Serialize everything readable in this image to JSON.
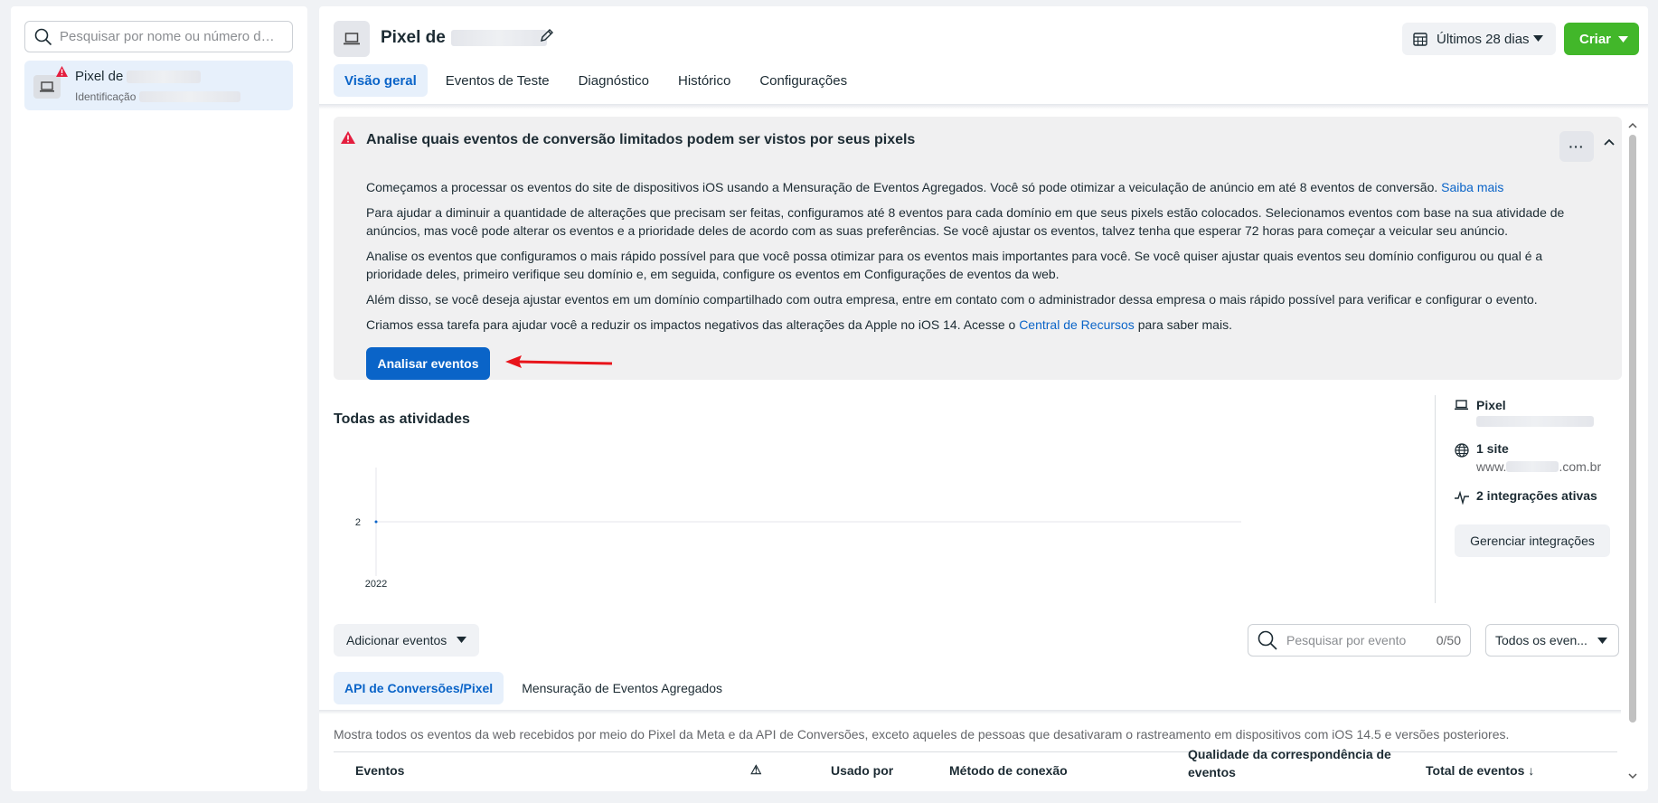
{
  "sidebar": {
    "search_placeholder": "Pesquisar por nome ou número de ide...",
    "pixel_name_prefix": "Pixel de",
    "pixel_sub_prefix": "Identificação"
  },
  "header": {
    "title_prefix": "Pixel de",
    "date_range": "Últimos 28 dias",
    "create_label": "Criar"
  },
  "tabs": [
    {
      "label": "Visão geral"
    },
    {
      "label": "Eventos de Teste"
    },
    {
      "label": "Diagnóstico"
    },
    {
      "label": "Histórico"
    },
    {
      "label": "Configurações"
    }
  ],
  "alert": {
    "title": "Analise quais eventos de conversão limitados podem ser vistos por seus pixels",
    "p1": "Começamos a processar os eventos do site de dispositivos iOS usando a Mensuração de Eventos Agregados. Você só pode otimizar a veiculação de anúncio em até 8 eventos de conversão.",
    "p1_link": "Saiba mais",
    "p2": "Para ajudar a diminuir a quantidade de alterações que precisam ser feitas, configuramos até 8 eventos para cada domínio em que seus pixels estão colocados. Selecionamos eventos com base na sua atividade de anúncios, mas você pode alterar os eventos e a prioridade deles de acordo com as suas preferências. Se você ajustar os eventos, talvez tenha que esperar 72 horas para começar a veicular seu anúncio.",
    "p3": "Analise os eventos que configuramos o mais rápido possível para que você possa otimizar para os eventos mais importantes para você. Se você quiser ajustar quais eventos seu domínio configurou ou qual é a prioridade deles, primeiro verifique seu domínio e, em seguida, configure os eventos em Configurações de eventos da web.",
    "p4": "Além disso, se você deseja ajustar eventos em um domínio compartilhado com outra empresa, entre em contato com o administrador dessa empresa o mais rápido possível para verificar e configurar o evento.",
    "p5_before": "Criamos essa tarefa para ajudar você a reduzir os impactos negativos das alterações da Apple no iOS 14. Acesse o",
    "p5_link": "Central de Recursos",
    "p5_after": "para saber mais.",
    "button": "Analisar eventos",
    "more": "···"
  },
  "activity": {
    "title": "Todas as atividades"
  },
  "chart_data": {
    "type": "line",
    "x": [
      "2022"
    ],
    "y_ticks": [
      "2"
    ],
    "series": [
      {
        "values": [
          2
        ]
      }
    ]
  },
  "side_info": {
    "pixel_label": "Pixel",
    "sites_label": "1 site",
    "site_prefix": "www.",
    "site_suffix": ".com.br",
    "integrations_label": "2 integrações ativas",
    "manage_button": "Gerenciar integrações"
  },
  "events": {
    "add_button": "Adicionar eventos",
    "search_placeholder": "Pesquisar por evento",
    "search_count": "0/50",
    "filter_value": "Todos os even...",
    "sub_tabs": [
      {
        "label": "API de Conversões/Pixel"
      },
      {
        "label": "Mensuração de Eventos Agregados"
      }
    ],
    "description": "Mostra todos os eventos da web recebidos por meio do Pixel da Meta e da API de Conversões, exceto aqueles de pessoas que desativaram o rastreamento em dispositivos com iOS 14.5 e versões posteriores.",
    "columns": {
      "events": "Eventos",
      "warning": "⚠",
      "used_by": "Usado por",
      "method": "Método de conexão",
      "quality": "Qualidade da correspondência de eventos",
      "total": "Total de eventos ↓"
    }
  }
}
